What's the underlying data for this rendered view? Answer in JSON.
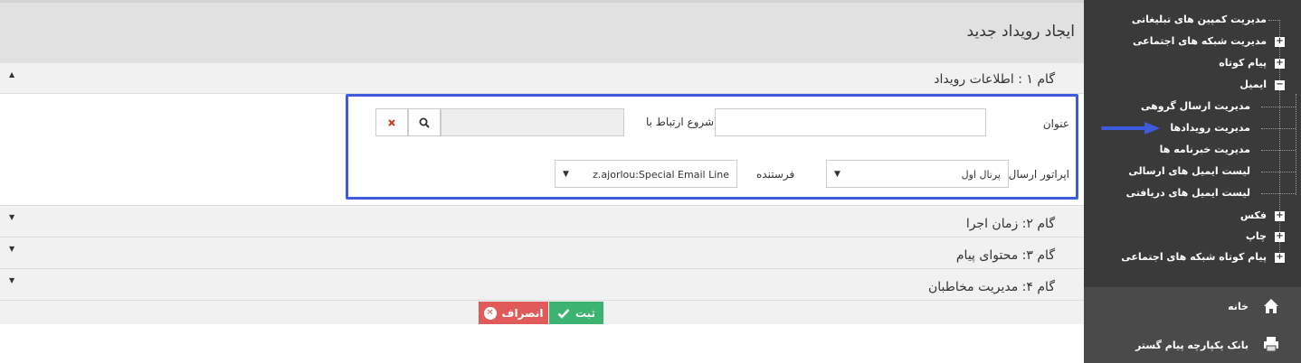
{
  "page": {
    "title": "ایجاد رویداد جدید"
  },
  "steps": [
    {
      "title": "گام ۱ : اطلاعات رویداد",
      "state": "expanded"
    },
    {
      "title": "گام ۲: زمان اجرا",
      "state": "collapsed"
    },
    {
      "title": "گام ۳: محتوای پیام",
      "state": "collapsed"
    },
    {
      "title": "گام ۴: مدیریت مخاطبان",
      "state": "collapsed"
    }
  ],
  "form": {
    "title_label": "عنوان",
    "title_value": "",
    "relation_label": "شروع ارتباط با",
    "relation_value": "",
    "operator_label": "اپراتور ارسال",
    "operator_value": "پرتال اول",
    "sender_label": "فرستنده",
    "sender_value": "z.ajorlou:Special Email Line"
  },
  "actions": {
    "save_label": "ثبت",
    "cancel_label": "انصراف"
  },
  "colors": {
    "accent": "#3f5bdd",
    "save": "#3cb371",
    "cancel": "#e05a5a",
    "sidebar": "#3a3a3a"
  },
  "sidebar": {
    "items": [
      {
        "label": "مدیریت کمپین های تبلیغاتی",
        "toggle": ""
      },
      {
        "label": "مدیریت شبکه های اجتماعی",
        "toggle": "+"
      },
      {
        "label": "پیام کوتاه",
        "toggle": "+"
      },
      {
        "label": "ایمیل",
        "toggle": "−"
      },
      {
        "label": "فکس",
        "toggle": "+"
      },
      {
        "label": "چاپ",
        "toggle": "+"
      },
      {
        "label": "پیام کوتاه شبکه های اجتماعی",
        "toggle": "+"
      }
    ],
    "email_children": [
      "مدیریت ارسال گروهی",
      "مدیریت رویدادها",
      "مدیریت خبرنامه ها",
      "لیست ایمیل های ارسالی",
      "لیست ایمیل های دریافتی"
    ],
    "home_label": "خانه",
    "bank_label": "بانک یکپارچه پیام گستر"
  }
}
